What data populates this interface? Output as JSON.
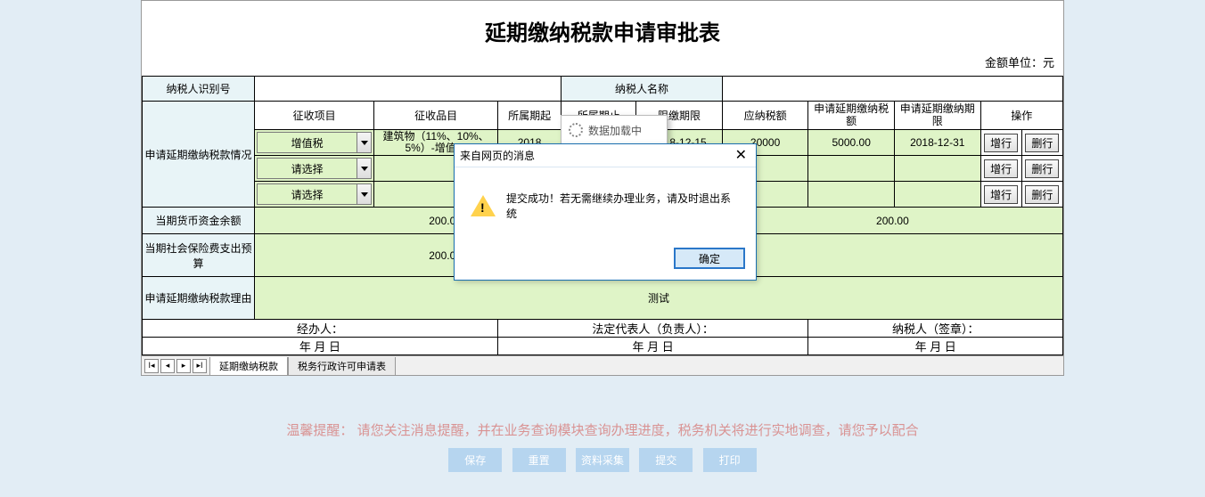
{
  "title": "延期缴纳税款申请审批表",
  "unit": "金额单位：元",
  "labels": {
    "taxpayer_id": "纳税人识别号",
    "taxpayer_name": "纳税人名称",
    "apply_situation": "申请延期缴纳税款情况",
    "cash_balance": "当期货币资金余额",
    "social_ins_budget": "当期社会保险费支出预算",
    "apply_reason": "申请延期缴纳税款理由"
  },
  "columns": {
    "levy_item": "征收项目",
    "levy_sub": "征收品目",
    "period_start": "所属期起",
    "period_end": "所属期止",
    "pay_deadline": "限缴期限",
    "tax_due": "应纳税额",
    "apply_amount": "申请延期缴纳税额",
    "apply_deadline": "申请延期缴纳期限",
    "ops": "操作"
  },
  "rows": [
    {
      "levy_item": "增值税",
      "levy_sub": "建筑物（11%、10%、5%）-增值…",
      "period_start": "2018",
      "period_end": "",
      "pay_deadline": "2018-12-15",
      "tax_due": "20000",
      "apply_amount": "5000.00",
      "apply_deadline": "2018-12-31"
    },
    {
      "levy_item": "请选择"
    },
    {
      "levy_item": "请选择"
    }
  ],
  "ops": {
    "add": "增行",
    "del": "删行"
  },
  "cash_balance_left": "200.00",
  "cash_balance_right": "200.00",
  "social_ins_value": "200.00",
  "reason_text": "测试",
  "sign": {
    "agent": "经办人：",
    "legal": "法定代表人（负责人）：",
    "taxpayer": "纳税人（签章）：",
    "date": "年    月    日"
  },
  "tabs": {
    "t1": "延期缴纳税款",
    "t2": "税务行政许可申请表"
  },
  "loading_text": "数据加载中",
  "modal": {
    "title": "来自网页的消息",
    "body": "提交成功！若无需继续办理业务，请及时退出系统",
    "ok": "确定"
  },
  "reminder": {
    "label": "温馨提醒：",
    "text": "请您关注消息提醒，并在业务查询模块查询办理进度，税务机关将进行实地调查，请您予以配合"
  },
  "actions": {
    "save": "保存",
    "reset": "重置",
    "collect": "资料采集",
    "submit": "提交",
    "print": "打印"
  }
}
